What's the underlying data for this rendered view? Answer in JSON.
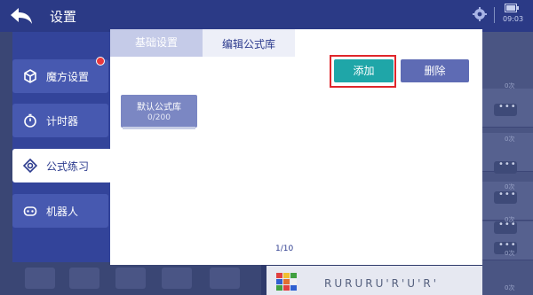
{
  "header": {
    "title": "设置",
    "back_icon": "back-arrow-icon",
    "settings_icon": "gear-icon",
    "time": "09:03"
  },
  "sidebar": {
    "items": [
      {
        "label": "魔方设置",
        "icon": "cube-icon",
        "has_badge": true
      },
      {
        "label": "计时器",
        "icon": "timer-icon"
      },
      {
        "label": "公式练习",
        "icon": "formula-icon",
        "active": true
      },
      {
        "label": "机器人",
        "icon": "robot-icon"
      }
    ]
  },
  "tabs": [
    {
      "label": "基础设置"
    },
    {
      "label": "编辑公式库",
      "active": true
    }
  ],
  "toolbar": {
    "add_label": "添加",
    "delete_label": "删除"
  },
  "library": {
    "name": "默认公式库",
    "count": "0/200"
  },
  "pager": {
    "text": "1/10"
  },
  "background": {
    "scramble": "RURURU'R'U'R'",
    "counts": [
      "0次",
      "0次",
      "0次",
      "0次",
      "0次",
      "0次"
    ]
  },
  "colors": {
    "header_bg": "#2b3a86",
    "sidebar_bg": "#33449a",
    "accent_add": "#1fa6a8",
    "accent_delete": "#5e6bb4",
    "highlight": "#e0262b"
  }
}
